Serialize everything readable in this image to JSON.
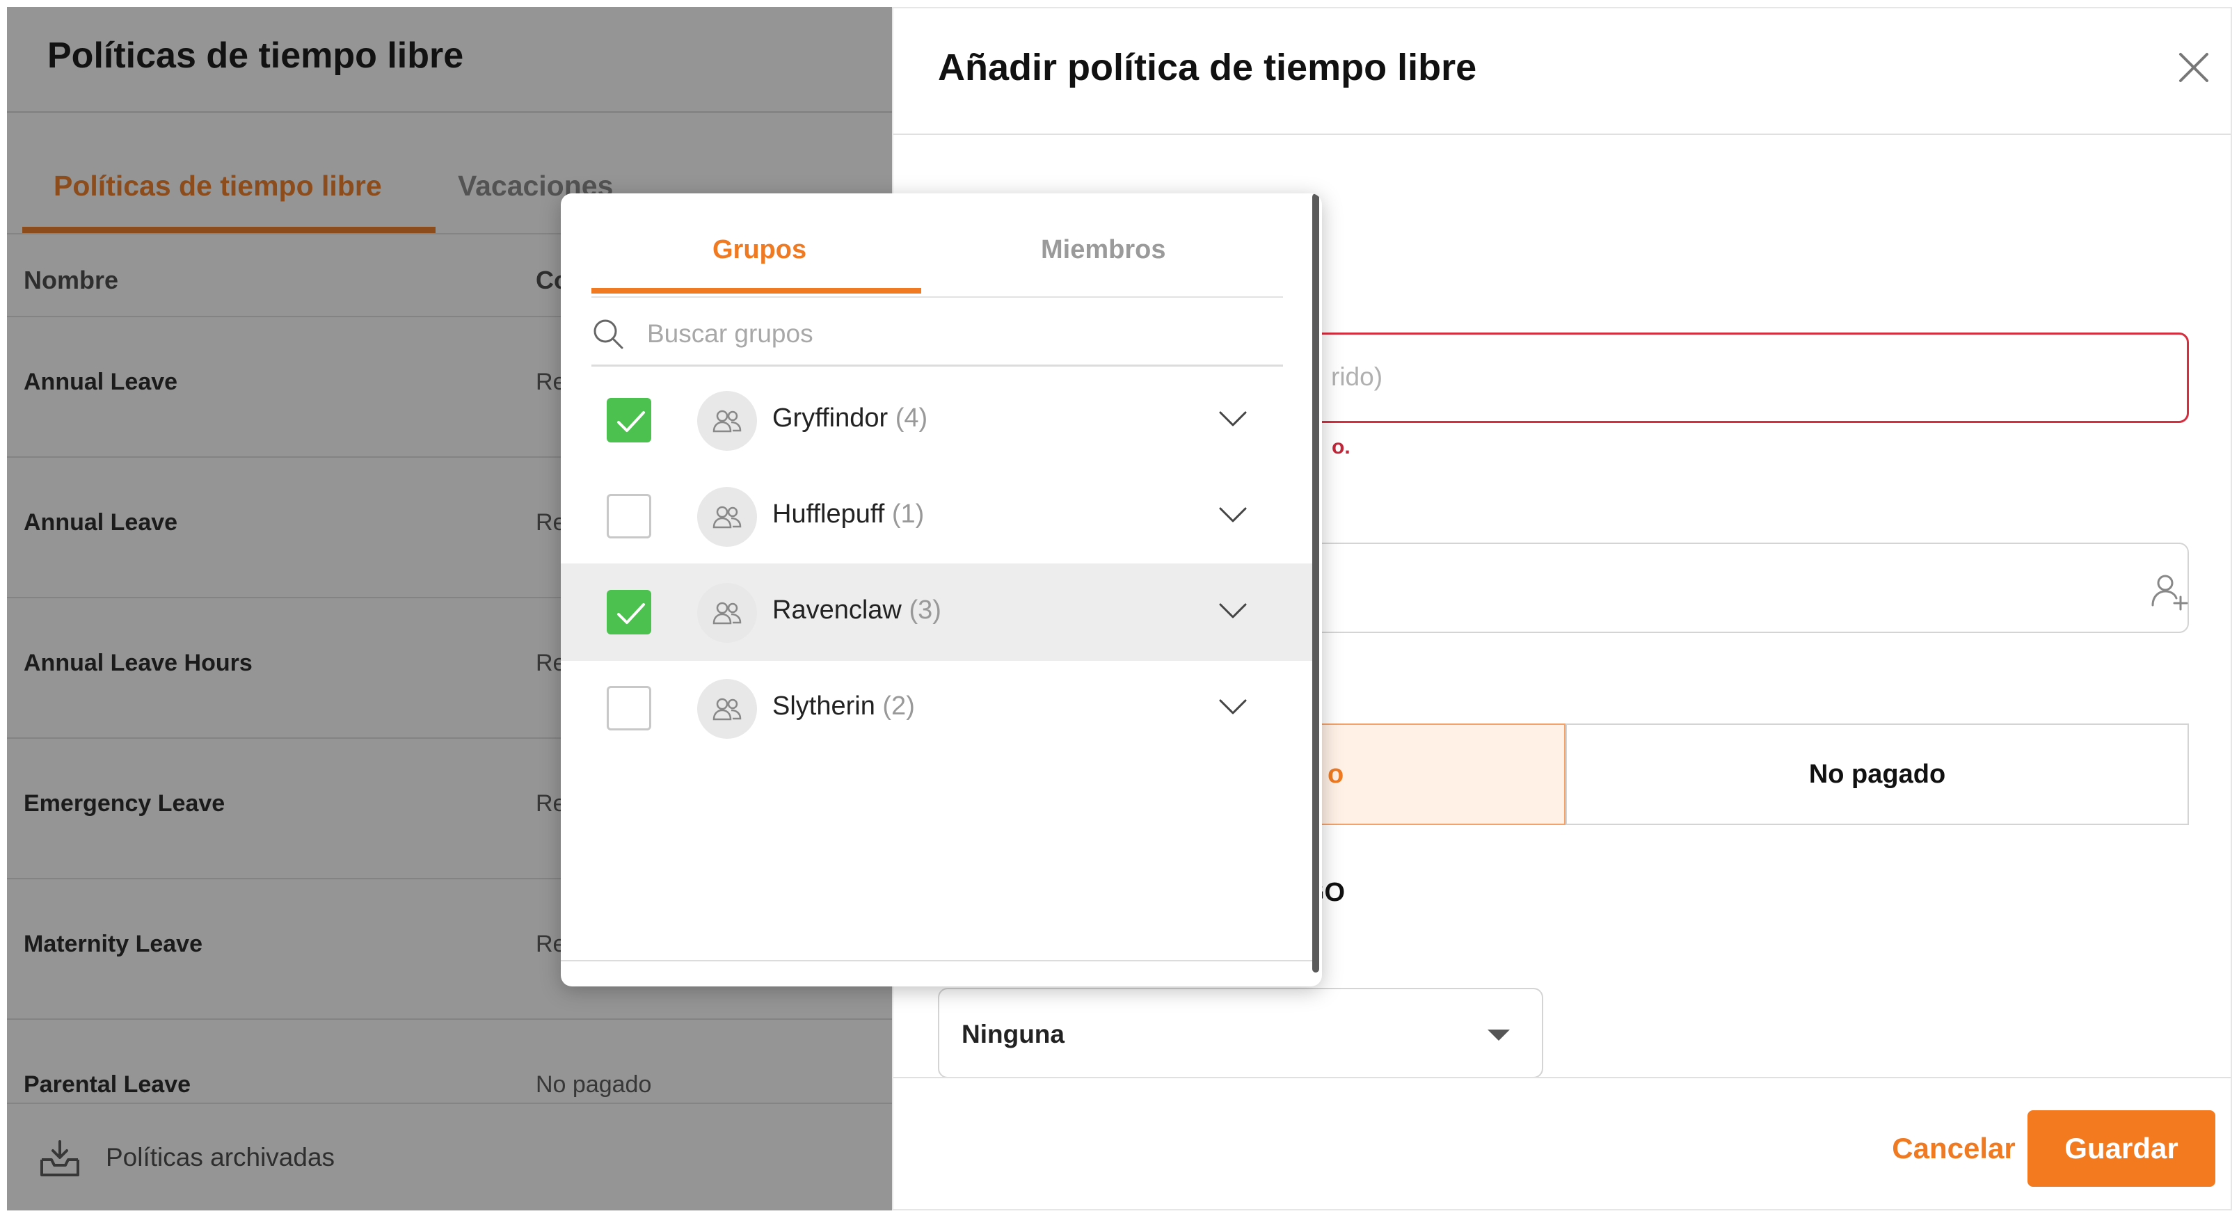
{
  "left_page": {
    "title": "Políticas de tiempo libre",
    "tabs": [
      "Políticas de tiempo libre",
      "Vacaciones"
    ],
    "columns": [
      "Nombre",
      "Co"
    ],
    "rows": [
      {
        "name": "Annual Leave",
        "type": "Re"
      },
      {
        "name": "Annual Leave",
        "type": "Re"
      },
      {
        "name": "Annual Leave Hours",
        "type": "Re"
      },
      {
        "name": "Emergency Leave",
        "type": "Re"
      },
      {
        "name": "Maternity Leave",
        "type": "Re"
      },
      {
        "name": "Parental Leave",
        "type": "No pagado"
      }
    ],
    "archived_label": "Políticas archivadas"
  },
  "drawer": {
    "title": "Añadir política de tiempo libre",
    "name_field_visible_text": "rido)",
    "name_error_visible_text": "o.",
    "paid_option_visible_text": "o",
    "unpaid_label": "No pagado",
    "accrual_label_visible_text": "GO",
    "select_value": "Ninguna",
    "cancel_label": "Cancelar",
    "save_label": "Guardar"
  },
  "picker": {
    "tabs": [
      "Grupos",
      "Miembros"
    ],
    "active_tab": "Grupos",
    "search_placeholder": "Buscar grupos",
    "groups": [
      {
        "name": "Gryffindor",
        "count": "(4)",
        "checked": true
      },
      {
        "name": "Hufflepuff",
        "count": "(1)",
        "checked": false
      },
      {
        "name": "Ravenclaw",
        "count": "(3)",
        "checked": true
      },
      {
        "name": "Slytherin",
        "count": "(2)",
        "checked": false
      }
    ]
  },
  "colors": {
    "accent": "#ef7a22",
    "checked": "#4cc14f",
    "error": "#d32f3f"
  }
}
